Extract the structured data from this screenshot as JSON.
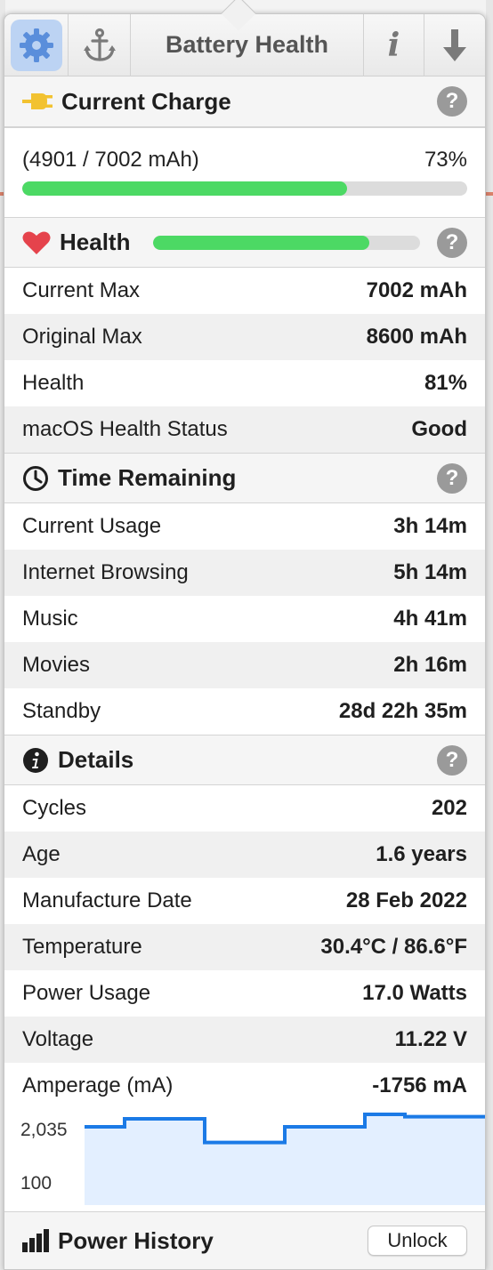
{
  "toolbar": {
    "title": "Battery Health",
    "info_glyph": "i",
    "icons": [
      "gear-icon",
      "anchor-icon",
      "info-icon",
      "download-arrow-icon"
    ]
  },
  "current_charge": {
    "title": "Current Charge",
    "help": "?",
    "mah_text": "(4901 / 7002 mAh)",
    "percent_text": "73%",
    "fraction": 0.73
  },
  "health": {
    "title": "Health",
    "help": "?",
    "fraction": 0.81,
    "rows": [
      {
        "label": "Current Max",
        "value": "7002 mAh"
      },
      {
        "label": "Original Max",
        "value": "8600 mAh"
      },
      {
        "label": "Health",
        "value": "81%"
      },
      {
        "label": "macOS Health Status",
        "value": "Good"
      }
    ]
  },
  "time_remaining": {
    "title": "Time Remaining",
    "help": "?",
    "rows": [
      {
        "label": "Current Usage",
        "value": "3h 14m"
      },
      {
        "label": "Internet Browsing",
        "value": "5h 14m"
      },
      {
        "label": "Music",
        "value": "4h 41m"
      },
      {
        "label": "Movies",
        "value": "2h 16m"
      },
      {
        "label": "Standby",
        "value": "28d 22h 35m"
      }
    ]
  },
  "details": {
    "title": "Details",
    "help": "?",
    "rows": [
      {
        "label": "Cycles",
        "value": "202"
      },
      {
        "label": "Age",
        "value": "1.6 years"
      },
      {
        "label": "Manufacture Date",
        "value": "28 Feb 2022"
      },
      {
        "label": "Temperature",
        "value": "30.4°C / 86.6°F"
      },
      {
        "label": "Power Usage",
        "value": "17.0 Watts"
      },
      {
        "label": "Voltage",
        "value": "11.22 V"
      },
      {
        "label": "Amperage (mA)",
        "value": "-1756 mA"
      }
    ]
  },
  "chart_data": {
    "type": "area",
    "ytick_labels": [
      "2,035",
      "100"
    ],
    "ylim": [
      100,
      2035
    ],
    "steps": [
      1740,
      1930,
      1930,
      1370,
      1370,
      1740,
      1740,
      2035,
      1980,
      1980
    ],
    "line_color": "#1b7ae6",
    "fill_color": "#e3efff"
  },
  "footer": {
    "title": "Power History",
    "unlock_label": "Unlock"
  },
  "colors": {
    "green_bar": "#4cd964",
    "heart": "#e5434c",
    "plug": "#f2c230",
    "help_badge": "#9a9a9a"
  }
}
